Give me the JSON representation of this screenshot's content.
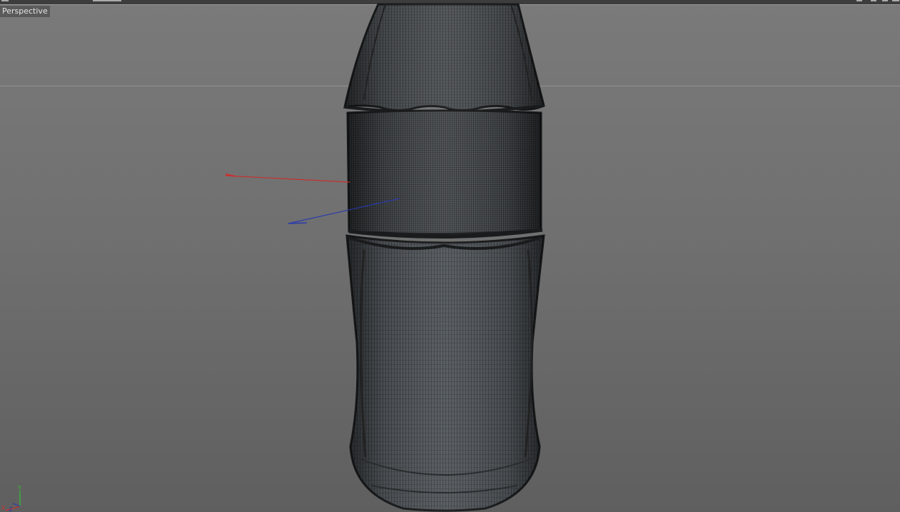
{
  "viewport": {
    "label": "Perspective"
  },
  "gizmo": {
    "y_label": "Y",
    "x_label": "X",
    "z_label": "Z"
  },
  "colors": {
    "background_top": "#7a7a7a",
    "background_bottom": "#5f5f5f",
    "mesh_fill": "#4a4e51",
    "wire": "#1e2022",
    "axis_x": "#c83030",
    "axis_y": "#30c030",
    "axis_z": "#2a3aaa"
  },
  "icons": [
    "viewport-menu-icon",
    "axis-gizmo-icon"
  ]
}
